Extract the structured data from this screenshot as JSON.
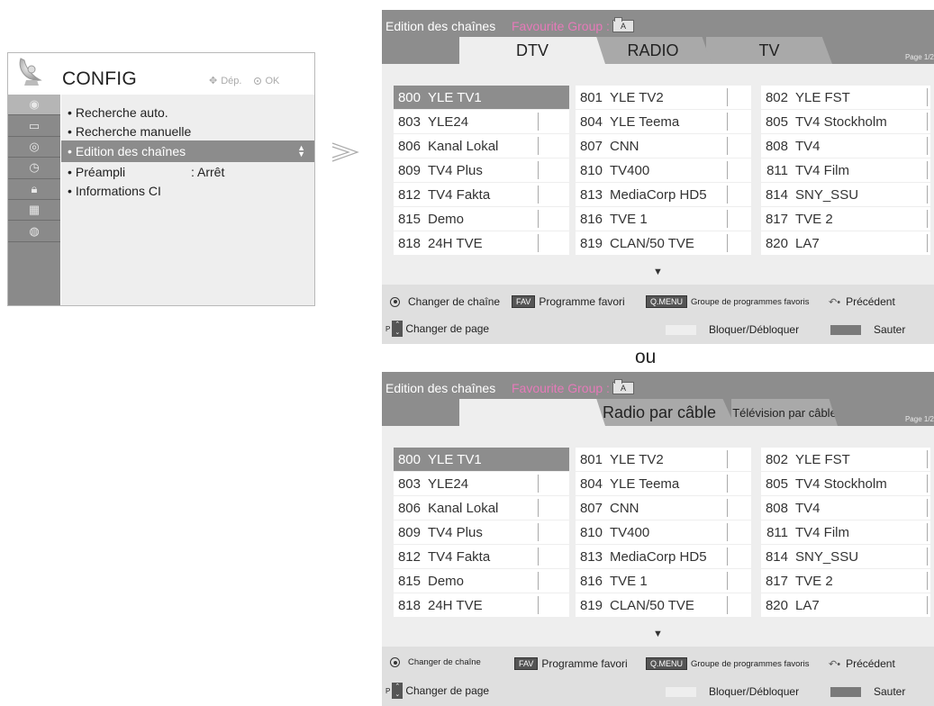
{
  "config_menu": {
    "title": "CONFIG",
    "hint_move": "Dép.",
    "hint_ok": "OK",
    "side_icons": [
      "antenna-icon",
      "picture-icon",
      "audio-icon",
      "clock-icon",
      "lock-icon",
      "calendar-icon",
      "globe-icon"
    ],
    "items": [
      {
        "label": "Recherche auto.",
        "value": ""
      },
      {
        "label": "Recherche manuelle",
        "value": ""
      },
      {
        "label": "Edition des chaînes",
        "value": "",
        "selected": true
      },
      {
        "label": "Préampli",
        "value": ": Arrêt"
      },
      {
        "label": "Informations CI",
        "value": ""
      }
    ]
  },
  "separator": "ou",
  "panels": [
    {
      "title": "Edition des chaînes",
      "favourite_label": "Favourite Group :",
      "favourite_value": "A",
      "tabs": [
        "DTV",
        "RADIO",
        "TV"
      ],
      "page": "Page 1/2",
      "columns": [
        [
          [
            "800",
            "YLE TV1"
          ],
          [
            "803",
            "YLE24"
          ],
          [
            "806",
            "Kanal Lokal"
          ],
          [
            "809",
            "TV4 Plus"
          ],
          [
            "812",
            "TV4 Fakta"
          ],
          [
            "815",
            "Demo"
          ],
          [
            "818",
            "24H TVE"
          ]
        ],
        [
          [
            "801",
            "YLE TV2"
          ],
          [
            "804",
            "YLE Teema"
          ],
          [
            "807",
            "CNN"
          ],
          [
            "810",
            "TV400"
          ],
          [
            "813",
            "MediaCorp HD5"
          ],
          [
            "816",
            "TVE 1"
          ],
          [
            "819",
            "CLAN/50 TVE"
          ]
        ],
        [
          [
            "802",
            "YLE FST"
          ],
          [
            "805",
            "TV4 Stockholm"
          ],
          [
            "808",
            "TV4"
          ],
          [
            "811",
            "TV4 Film"
          ],
          [
            "814",
            "SNY_SSU"
          ],
          [
            "817",
            "TVE 2"
          ],
          [
            "820",
            "LA7"
          ]
        ]
      ],
      "footer": {
        "change_channel": "Changer de chaîne",
        "fav_key": "FAV",
        "fav_label": "Programme favori",
        "qmenu_key": "Q.MENU",
        "qmenu_label": "Groupe de programmes favoris",
        "back_label": "Précédent",
        "p_label": "P",
        "page_label": "Changer de page",
        "lock_label": "Bloquer/Débloquer",
        "skip_label": "Sauter"
      }
    },
    {
      "title": "Edition des chaînes",
      "favourite_label": "Favourite Group :",
      "favourite_value": "A",
      "tabs": [
        "",
        "Radio par câble",
        "Télévision par câble"
      ],
      "page": "Page 1/2",
      "columns": [
        [
          [
            "800",
            "YLE TV1"
          ],
          [
            "803",
            "YLE24"
          ],
          [
            "806",
            "Kanal Lokal"
          ],
          [
            "809",
            "TV4 Plus"
          ],
          [
            "812",
            "TV4 Fakta"
          ],
          [
            "815",
            "Demo"
          ],
          [
            "818",
            "24H TVE"
          ]
        ],
        [
          [
            "801",
            "YLE TV2"
          ],
          [
            "804",
            "YLE Teema"
          ],
          [
            "807",
            "CNN"
          ],
          [
            "810",
            "TV400"
          ],
          [
            "813",
            "MediaCorp HD5"
          ],
          [
            "816",
            "TVE 1"
          ],
          [
            "819",
            "CLAN/50 TVE"
          ]
        ],
        [
          [
            "802",
            "YLE FST"
          ],
          [
            "805",
            "TV4 Stockholm"
          ],
          [
            "808",
            "TV4"
          ],
          [
            "811",
            "TV4 Film"
          ],
          [
            "814",
            "SNY_SSU"
          ],
          [
            "817",
            "TVE 2"
          ],
          [
            "820",
            "LA7"
          ]
        ]
      ],
      "footer": {
        "change_channel": "Changer de chaîne",
        "fav_key": "FAV",
        "fav_label": "Programme favori",
        "qmenu_key": "Q.MENU",
        "qmenu_label": "Groupe de programmes favoris",
        "back_label": "Précédent",
        "p_label": "P",
        "page_label": "Changer de page",
        "lock_label": "Bloquer/Débloquer",
        "skip_label": "Sauter"
      }
    }
  ],
  "colors": {
    "selected": "#8d8d8d",
    "favourite": "#e67ab9",
    "lock_swatch": "#eeeeee",
    "skip_swatch": "#7a7a7a"
  }
}
